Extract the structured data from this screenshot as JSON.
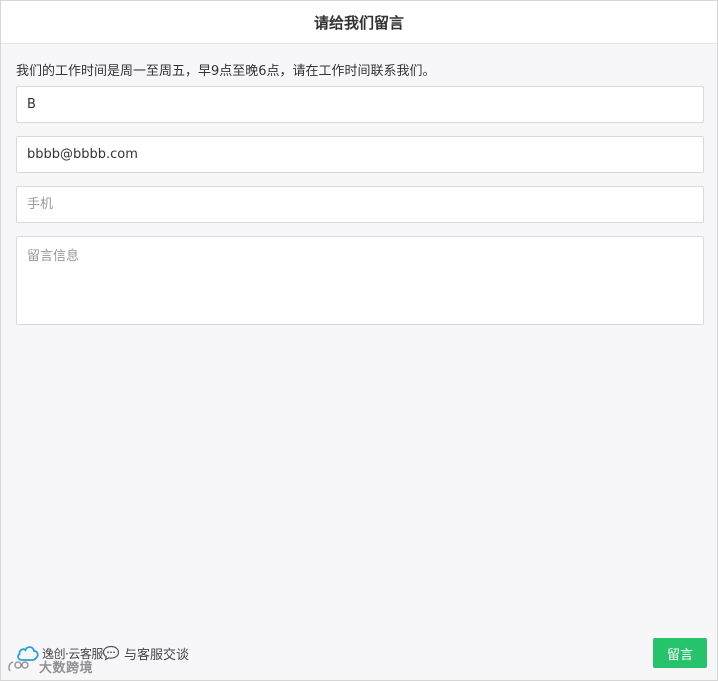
{
  "header": {
    "title": "请给我们留言"
  },
  "notice": "我们的工作时间是周一至周五，早9点至晚6点，请在工作时间联系我们。",
  "form": {
    "name": {
      "value": "B",
      "placeholder": ""
    },
    "email": {
      "value": "bbbb@bbbb.com",
      "placeholder": ""
    },
    "phone": {
      "value": "",
      "placeholder": "手机"
    },
    "message": {
      "value": "",
      "placeholder": "留言信息"
    }
  },
  "footer": {
    "brand": "逸创·云客服",
    "brand_icon": "cloud-icon",
    "chat_label": "与客服交谈",
    "chat_icon": "chat-bubble-icon",
    "submit_label": "留言",
    "watermark": "大数跨境"
  },
  "colors": {
    "accent": "#27c26c",
    "brand_icon": "#2a9fd8"
  }
}
